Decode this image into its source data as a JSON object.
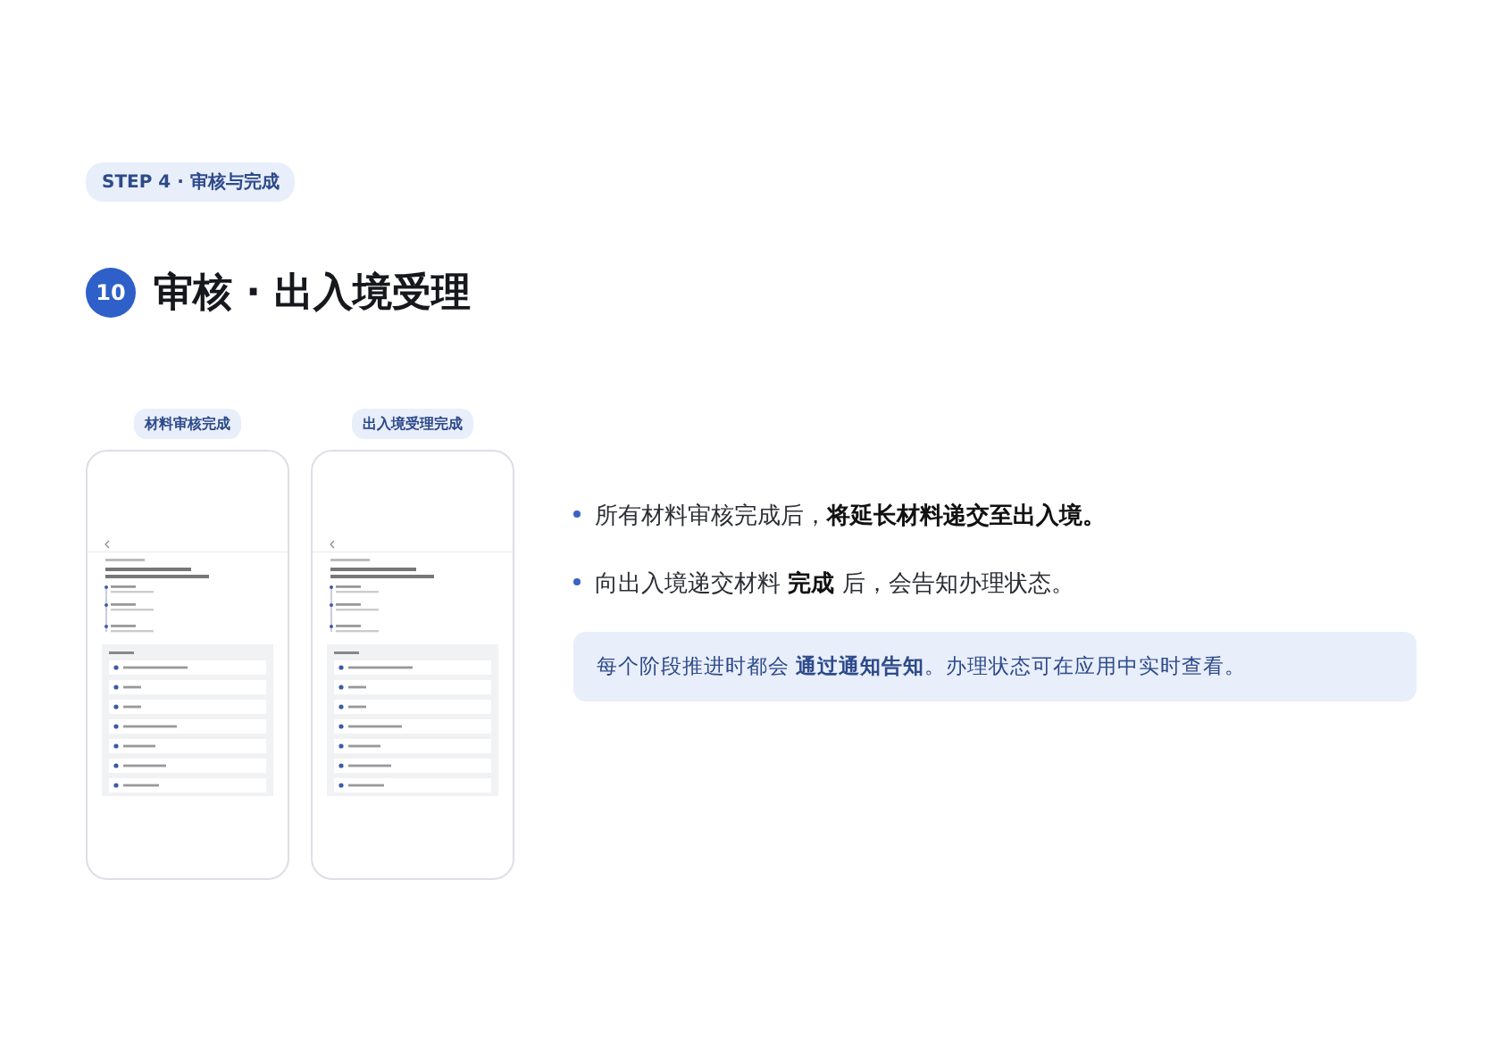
{
  "step_badge": "STEP 4 · 审核与完成",
  "title": {
    "number": "10",
    "text": "审核 · 出入境受理"
  },
  "phones": [
    {
      "label": "材料审核完成"
    },
    {
      "label": "出入境受理完成"
    }
  ],
  "bullets": [
    "所有材料审核完成后，**将延长材料递交至出入境。**",
    "向出入境递交材料 **完成** 后，会告知办理状态。"
  ],
  "note": "每个阶段推进时都会 **通过通知告知**。办理状态可在应用中实时查看。"
}
